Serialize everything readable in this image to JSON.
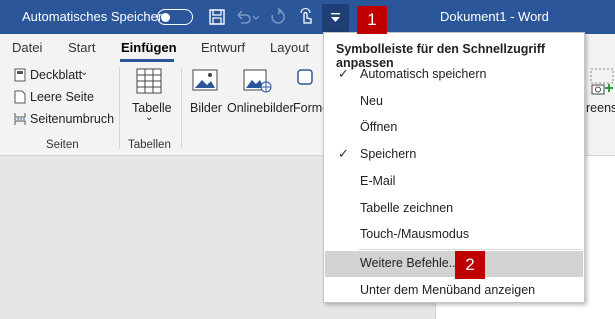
{
  "titlebar": {
    "autosave_label": "Automatisches Speichern",
    "doc_title": "Dokument1 - Word"
  },
  "badges": [
    "1",
    "2"
  ],
  "tabs": [
    "Datei",
    "Start",
    "Einfügen",
    "Entwurf",
    "Layout"
  ],
  "ribbon": {
    "seiten": {
      "deckblatt": "Deckblatt",
      "leere_seite": "Leere Seite",
      "seitenumbruch": "Seitenumbruch",
      "group": "Seiten"
    },
    "tabellen": {
      "tabelle": "Tabelle",
      "group": "Tabellen"
    },
    "bilder": "Bilder",
    "onlinebilder": "Onlinebilder",
    "formen": "Forme",
    "screenshot": "reens"
  },
  "menu": {
    "header": "Symbolleiste für den Schnellzugriff anpassen",
    "items": [
      {
        "label": "Automatisch speichern",
        "checked": "✓"
      },
      {
        "label": "Neu",
        "checked": ""
      },
      {
        "label": "Öffnen",
        "checked": ""
      },
      {
        "label": "Speichern",
        "checked": "✓"
      },
      {
        "label": "E-Mail",
        "checked": ""
      },
      {
        "label": "Tabelle zeichnen",
        "checked": ""
      },
      {
        "label": "Touch-/Mausmodus",
        "checked": ""
      }
    ],
    "weitere": "Weitere Befehle...",
    "unter": "Unter dem Menüband anzeigen"
  },
  "colors": {
    "titlebar": "#2b579a",
    "badge": "#c00000",
    "highlight": "#d2d2d2"
  }
}
